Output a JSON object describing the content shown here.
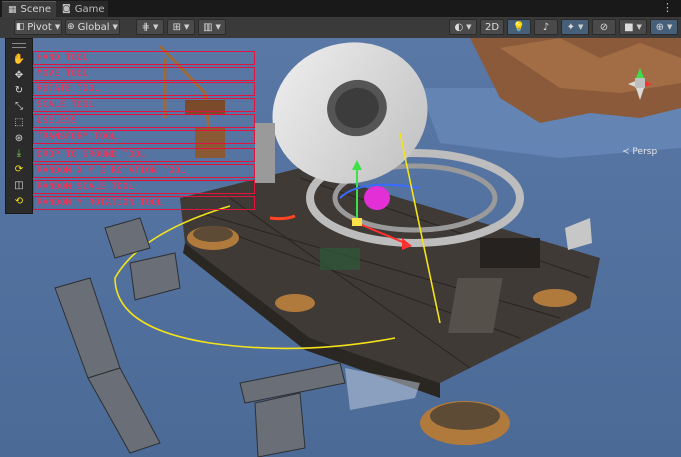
{
  "tabs": [
    {
      "label": "Scene",
      "icon": "grid-icon",
      "active": true
    },
    {
      "label": "Game",
      "icon": "gamepad-icon",
      "active": false
    }
  ],
  "menu_icon": "kebab-icon",
  "toolbar": {
    "pivot_label": "Pivot",
    "global_label": "Global",
    "mode_2d_label": "2D"
  },
  "scene_view": {
    "projection_label": "Persp"
  },
  "tools": [
    {
      "label": "HAND TOOL",
      "icon": "hand-icon"
    },
    {
      "label": "MOVE TOOL",
      "icon": "move-icon"
    },
    {
      "label": "ROTATE TOOL",
      "icon": "rotate-icon"
    },
    {
      "label": "SCALE TOOL",
      "icon": "scale-icon"
    },
    {
      "label": "USELESS",
      "icon": "rect-icon"
    },
    {
      "label": "TRANSFORM TOOL",
      "icon": "transform-icon"
    },
    {
      "label": "DROP TO GROUND TOOL",
      "icon": "drop-icon"
    },
    {
      "label": "RANDOM X Y Z ROTATION TOOL",
      "icon": "random-rotation-icon"
    },
    {
      "label": "RANDOM SCALE TOOL",
      "icon": "random-scale-icon"
    },
    {
      "label": "RANDOM Y ROTATION TOOL",
      "icon": "random-y-rotation-icon"
    }
  ],
  "colors": {
    "label_border": "#e0143c",
    "label_text": "#ff2a4a",
    "toolbar_bg": "#3a3a3a",
    "sky": "#4f6f9a",
    "accent_blue": "#46607a"
  }
}
